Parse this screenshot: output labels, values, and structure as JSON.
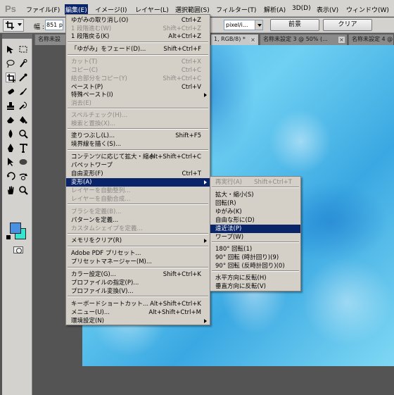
{
  "menubar": {
    "logo": "Ps",
    "items": [
      {
        "label": "ファイル(F)"
      },
      {
        "label": "編集(E)"
      },
      {
        "label": "イメージ(I)"
      },
      {
        "label": "レイヤー(L)"
      },
      {
        "label": "選択範囲(S)"
      },
      {
        "label": "フィルター(T)"
      },
      {
        "label": "解析(A)"
      },
      {
        "label": "3D(D)"
      },
      {
        "label": "表示(V)"
      },
      {
        "label": "ウィンドウ(W)"
      }
    ]
  },
  "options": {
    "width_label": "幅 :",
    "width_value": "851 p",
    "unit_value": "pixel/i...",
    "front_button": "前景",
    "clear_button": "クリア"
  },
  "tabs": [
    {
      "label": "名称未設"
    },
    {
      "label": "1, RGB/8) *"
    },
    {
      "label": "名称未設定 3 @ 50% (..."
    },
    {
      "label": "名称未設定 4 @ 5"
    }
  ],
  "edit_menu": [
    {
      "label": "ゆがみの取り消し(O)",
      "shortcut": "Ctrl+Z",
      "disabled": false
    },
    {
      "label": "1 段階進む(W)",
      "shortcut": "Shift+Ctrl+Z",
      "disabled": true
    },
    {
      "label": "1 段階戻る(K)",
      "shortcut": "Alt+Ctrl+Z",
      "disabled": false
    },
    {
      "label": "「ゆがみ」をフェード(D)...",
      "shortcut": "Shift+Ctrl+F",
      "disabled": false
    },
    {
      "label": "カット(T)",
      "shortcut": "Ctrl+X",
      "disabled": true
    },
    {
      "label": "コピー(C)",
      "shortcut": "Ctrl+C",
      "disabled": true
    },
    {
      "label": "結合部分をコピー(Y)",
      "shortcut": "Shift+Ctrl+C",
      "disabled": true
    },
    {
      "label": "ペースト(P)",
      "shortcut": "Ctrl+V",
      "disabled": false
    },
    {
      "label": "特殊ペースト(I)",
      "shortcut": "",
      "disabled": false,
      "submenu": true
    },
    {
      "label": "消去(E)",
      "shortcut": "",
      "disabled": true
    },
    {
      "label": "スペルチェック(H)...",
      "shortcut": "",
      "disabled": true
    },
    {
      "label": "検索と置換(X)...",
      "shortcut": "",
      "disabled": true
    },
    {
      "label": "塗りつぶし(L)...",
      "shortcut": "Shift+F5",
      "disabled": false
    },
    {
      "label": "境界線を描く(S)...",
      "shortcut": "",
      "disabled": false
    },
    {
      "label": "コンテンツに応じて拡大・縮小",
      "shortcut": "Alt+Shift+Ctrl+C",
      "disabled": false
    },
    {
      "label": "パペットワープ",
      "shortcut": "",
      "disabled": false
    },
    {
      "label": "自由変形(F)",
      "shortcut": "Ctrl+T",
      "disabled": false
    },
    {
      "label": "変形(A)",
      "shortcut": "",
      "disabled": false,
      "submenu": true,
      "highlighted": true
    },
    {
      "label": "レイヤーを自動整列...",
      "shortcut": "",
      "disabled": true
    },
    {
      "label": "レイヤーを自動合成...",
      "shortcut": "",
      "disabled": true
    },
    {
      "label": "ブラシを定義(B)...",
      "shortcut": "",
      "disabled": true
    },
    {
      "label": "パターンを定義...",
      "shortcut": "",
      "disabled": false
    },
    {
      "label": "カスタムシェイプを定義...",
      "shortcut": "",
      "disabled": true
    },
    {
      "label": "メモリをクリア(R)",
      "shortcut": "",
      "disabled": false,
      "submenu": true
    },
    {
      "label": "Adobe PDF プリセット...",
      "shortcut": "",
      "disabled": false
    },
    {
      "label": "プリセットマネージャー(M)...",
      "shortcut": "",
      "disabled": false
    },
    {
      "label": "カラー設定(G)...",
      "shortcut": "Shift+Ctrl+K",
      "disabled": false
    },
    {
      "label": "プロファイルの指定(P)...",
      "shortcut": "",
      "disabled": false
    },
    {
      "label": "プロファイル変換(V)...",
      "shortcut": "",
      "disabled": false
    },
    {
      "label": "キーボードショートカット...",
      "shortcut": "Alt+Shift+Ctrl+K",
      "disabled": false
    },
    {
      "label": "メニュー(U)...",
      "shortcut": "Alt+Shift+Ctrl+M",
      "disabled": false
    },
    {
      "label": "環境設定(N)",
      "shortcut": "",
      "disabled": false,
      "submenu": true
    }
  ],
  "transform_menu": [
    {
      "label": "再実行(A)",
      "shortcut": "Shift+Ctrl+T",
      "disabled": true
    },
    {
      "label": "拡大・縮小(S)",
      "shortcut": "",
      "disabled": false
    },
    {
      "label": "回転(R)",
      "shortcut": "",
      "disabled": false
    },
    {
      "label": "ゆがみ(K)",
      "shortcut": "",
      "disabled": false
    },
    {
      "label": "自由な形に(D)",
      "shortcut": "",
      "disabled": false
    },
    {
      "label": "遠近法(P)",
      "shortcut": "",
      "disabled": false,
      "highlighted": true
    },
    {
      "label": "ワープ(W)",
      "shortcut": "",
      "disabled": false
    },
    {
      "label": "180° 回転(1)",
      "shortcut": "",
      "disabled": false
    },
    {
      "label": "90° 回転 (時計回り)(9)",
      "shortcut": "",
      "disabled": false
    },
    {
      "label": "90° 回転 (反時計回り)(0)",
      "shortcut": "",
      "disabled": false
    },
    {
      "label": "水平方向に反転(H)",
      "shortcut": "",
      "disabled": false
    },
    {
      "label": "垂直方向に反転(V)",
      "shortcut": "",
      "disabled": false
    }
  ],
  "colors": {
    "foreground": "#4a90e2",
    "background": "#36e4d0",
    "menu_highlight": "#0a246a"
  },
  "tool_icons": [
    "move-icon",
    "marquee-icon",
    "lasso-icon",
    "quick-select-icon",
    "crop-icon",
    "eyedropper-icon",
    "healing-brush-icon",
    "brush-icon",
    "clone-stamp-icon",
    "history-brush-icon",
    "eraser-icon",
    "gradient-icon",
    "blur-icon",
    "dodge-icon",
    "pen-icon",
    "type-icon",
    "path-select-icon",
    "shape-icon",
    "3d-rotate-icon",
    "3d-camera-icon",
    "hand-icon",
    "zoom-icon"
  ]
}
